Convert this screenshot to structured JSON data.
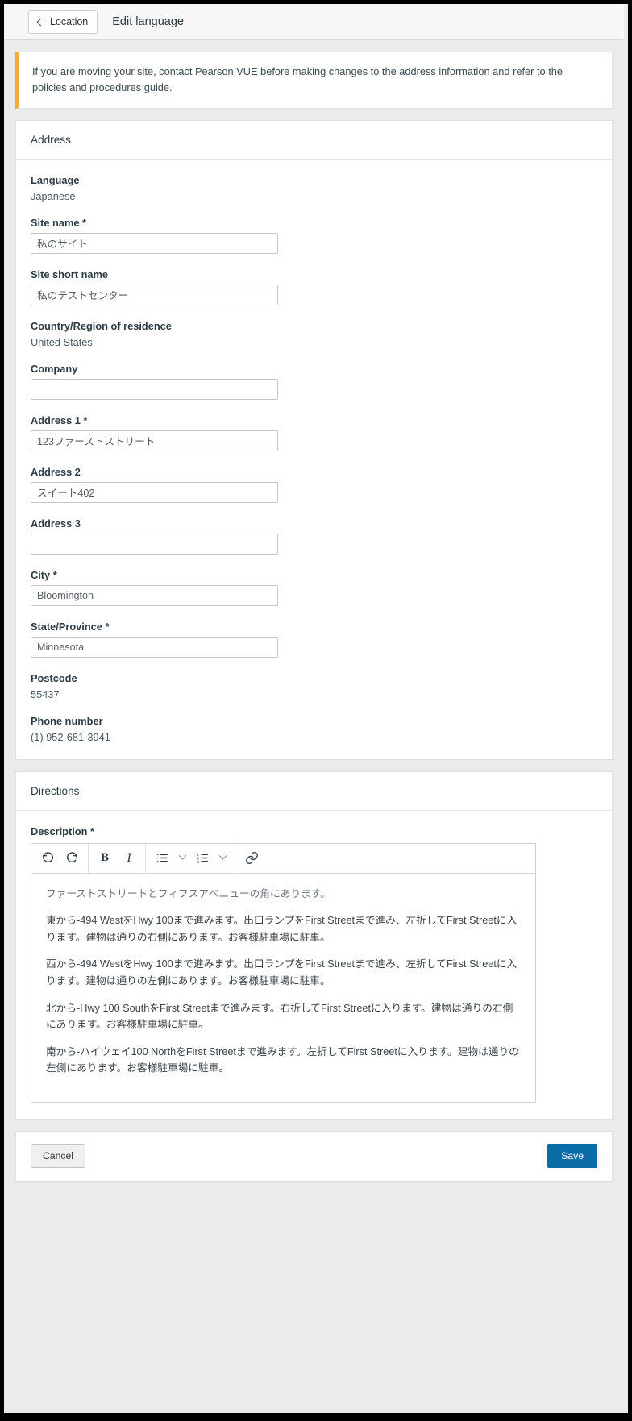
{
  "header": {
    "back_button_label": "Location",
    "page_title": "Edit language"
  },
  "alert": {
    "message": "If you are moving your site, contact Pearson VUE before making changes to the address information and refer to the policies and procedures guide.",
    "accent_color": "#f0ad3c"
  },
  "address_panel": {
    "title": "Address",
    "fields": {
      "language": {
        "label": "Language",
        "value": "Japanese"
      },
      "site_name": {
        "label": "Site name *",
        "value": "私のサイト"
      },
      "site_short_name": {
        "label": "Site short name",
        "value": "私のテストセンター"
      },
      "country_region": {
        "label": "Country/Region of residence",
        "value": "United States"
      },
      "company": {
        "label": "Company",
        "value": ""
      },
      "address1": {
        "label": "Address 1 *",
        "value": "123ファーストストリート"
      },
      "address2": {
        "label": "Address 2",
        "value": "スイート402"
      },
      "address3": {
        "label": "Address 3",
        "value": ""
      },
      "city": {
        "label": "City *",
        "value": "Bloomington"
      },
      "state_province": {
        "label": "State/Province *",
        "value": "Minnesota"
      },
      "postcode": {
        "label": "Postcode",
        "value": "55437"
      },
      "phone_number": {
        "label": "Phone number",
        "value": "(1) 952-681-3941"
      }
    }
  },
  "directions_panel": {
    "title": "Directions",
    "description_label": "Description *",
    "toolbar": {
      "undo": "undo-icon",
      "redo": "redo-icon",
      "bold": "B",
      "italic": "I",
      "bullet_list": "bullet-list-icon",
      "bullet_list_dropdown": "chevron-down-icon",
      "numbered_list": "numbered-list-icon",
      "numbered_list_dropdown": "chevron-down-icon",
      "link": "link-icon"
    },
    "content": [
      "ファーストストリートとフィフスアベニューの角にあります。",
      "東から-494 WestをHwy 100まで進みます。出口ランプをFirst Streetまで進み、左折してFirst Streetに入ります。建物は通りの右側にあります。お客様駐車場に駐車。",
      "西から-494 WestをHwy 100まで進みます。出口ランプをFirst Streetまで進み、左折してFirst Streetに入ります。建物は通りの左側にあります。お客様駐車場に駐車。",
      "北から-Hwy 100 SouthをFirst Streetまで進みます。右折してFirst Streetに入ります。建物は通りの右側にあります。お客様駐車場に駐車。",
      "南から-ハイウェイ100 NorthをFirst Streetまで進みます。左折してFirst Streetに入ります。建物は通りの左側にあります。お客様駐車場に駐車。"
    ]
  },
  "footer": {
    "cancel_label": "Cancel",
    "save_label": "Save",
    "save_color": "#0a6ba6"
  }
}
